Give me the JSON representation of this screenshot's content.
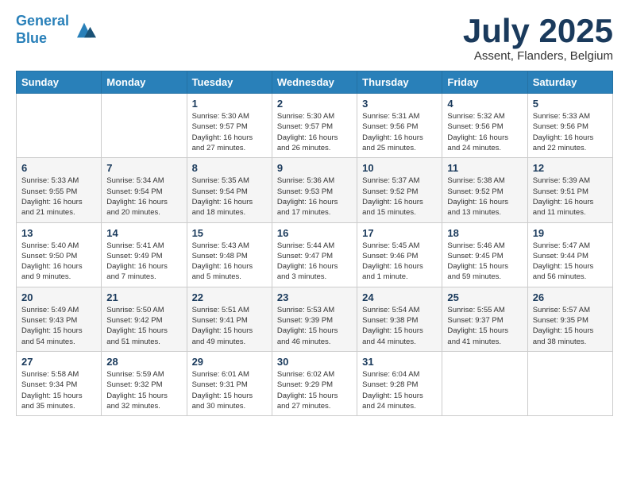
{
  "logo": {
    "line1": "General",
    "line2": "Blue"
  },
  "title": "July 2025",
  "subtitle": "Assent, Flanders, Belgium",
  "weekdays": [
    "Sunday",
    "Monday",
    "Tuesday",
    "Wednesday",
    "Thursday",
    "Friday",
    "Saturday"
  ],
  "weeks": [
    [
      {
        "day": "",
        "info": ""
      },
      {
        "day": "",
        "info": ""
      },
      {
        "day": "1",
        "info": "Sunrise: 5:30 AM\nSunset: 9:57 PM\nDaylight: 16 hours and 27 minutes."
      },
      {
        "day": "2",
        "info": "Sunrise: 5:30 AM\nSunset: 9:57 PM\nDaylight: 16 hours and 26 minutes."
      },
      {
        "day": "3",
        "info": "Sunrise: 5:31 AM\nSunset: 9:56 PM\nDaylight: 16 hours and 25 minutes."
      },
      {
        "day": "4",
        "info": "Sunrise: 5:32 AM\nSunset: 9:56 PM\nDaylight: 16 hours and 24 minutes."
      },
      {
        "day": "5",
        "info": "Sunrise: 5:33 AM\nSunset: 9:56 PM\nDaylight: 16 hours and 22 minutes."
      }
    ],
    [
      {
        "day": "6",
        "info": "Sunrise: 5:33 AM\nSunset: 9:55 PM\nDaylight: 16 hours and 21 minutes."
      },
      {
        "day": "7",
        "info": "Sunrise: 5:34 AM\nSunset: 9:54 PM\nDaylight: 16 hours and 20 minutes."
      },
      {
        "day": "8",
        "info": "Sunrise: 5:35 AM\nSunset: 9:54 PM\nDaylight: 16 hours and 18 minutes."
      },
      {
        "day": "9",
        "info": "Sunrise: 5:36 AM\nSunset: 9:53 PM\nDaylight: 16 hours and 17 minutes."
      },
      {
        "day": "10",
        "info": "Sunrise: 5:37 AM\nSunset: 9:52 PM\nDaylight: 16 hours and 15 minutes."
      },
      {
        "day": "11",
        "info": "Sunrise: 5:38 AM\nSunset: 9:52 PM\nDaylight: 16 hours and 13 minutes."
      },
      {
        "day": "12",
        "info": "Sunrise: 5:39 AM\nSunset: 9:51 PM\nDaylight: 16 hours and 11 minutes."
      }
    ],
    [
      {
        "day": "13",
        "info": "Sunrise: 5:40 AM\nSunset: 9:50 PM\nDaylight: 16 hours and 9 minutes."
      },
      {
        "day": "14",
        "info": "Sunrise: 5:41 AM\nSunset: 9:49 PM\nDaylight: 16 hours and 7 minutes."
      },
      {
        "day": "15",
        "info": "Sunrise: 5:43 AM\nSunset: 9:48 PM\nDaylight: 16 hours and 5 minutes."
      },
      {
        "day": "16",
        "info": "Sunrise: 5:44 AM\nSunset: 9:47 PM\nDaylight: 16 hours and 3 minutes."
      },
      {
        "day": "17",
        "info": "Sunrise: 5:45 AM\nSunset: 9:46 PM\nDaylight: 16 hours and 1 minute."
      },
      {
        "day": "18",
        "info": "Sunrise: 5:46 AM\nSunset: 9:45 PM\nDaylight: 15 hours and 59 minutes."
      },
      {
        "day": "19",
        "info": "Sunrise: 5:47 AM\nSunset: 9:44 PM\nDaylight: 15 hours and 56 minutes."
      }
    ],
    [
      {
        "day": "20",
        "info": "Sunrise: 5:49 AM\nSunset: 9:43 PM\nDaylight: 15 hours and 54 minutes."
      },
      {
        "day": "21",
        "info": "Sunrise: 5:50 AM\nSunset: 9:42 PM\nDaylight: 15 hours and 51 minutes."
      },
      {
        "day": "22",
        "info": "Sunrise: 5:51 AM\nSunset: 9:41 PM\nDaylight: 15 hours and 49 minutes."
      },
      {
        "day": "23",
        "info": "Sunrise: 5:53 AM\nSunset: 9:39 PM\nDaylight: 15 hours and 46 minutes."
      },
      {
        "day": "24",
        "info": "Sunrise: 5:54 AM\nSunset: 9:38 PM\nDaylight: 15 hours and 44 minutes."
      },
      {
        "day": "25",
        "info": "Sunrise: 5:55 AM\nSunset: 9:37 PM\nDaylight: 15 hours and 41 minutes."
      },
      {
        "day": "26",
        "info": "Sunrise: 5:57 AM\nSunset: 9:35 PM\nDaylight: 15 hours and 38 minutes."
      }
    ],
    [
      {
        "day": "27",
        "info": "Sunrise: 5:58 AM\nSunset: 9:34 PM\nDaylight: 15 hours and 35 minutes."
      },
      {
        "day": "28",
        "info": "Sunrise: 5:59 AM\nSunset: 9:32 PM\nDaylight: 15 hours and 32 minutes."
      },
      {
        "day": "29",
        "info": "Sunrise: 6:01 AM\nSunset: 9:31 PM\nDaylight: 15 hours and 30 minutes."
      },
      {
        "day": "30",
        "info": "Sunrise: 6:02 AM\nSunset: 9:29 PM\nDaylight: 15 hours and 27 minutes."
      },
      {
        "day": "31",
        "info": "Sunrise: 6:04 AM\nSunset: 9:28 PM\nDaylight: 15 hours and 24 minutes."
      },
      {
        "day": "",
        "info": ""
      },
      {
        "day": "",
        "info": ""
      }
    ]
  ]
}
